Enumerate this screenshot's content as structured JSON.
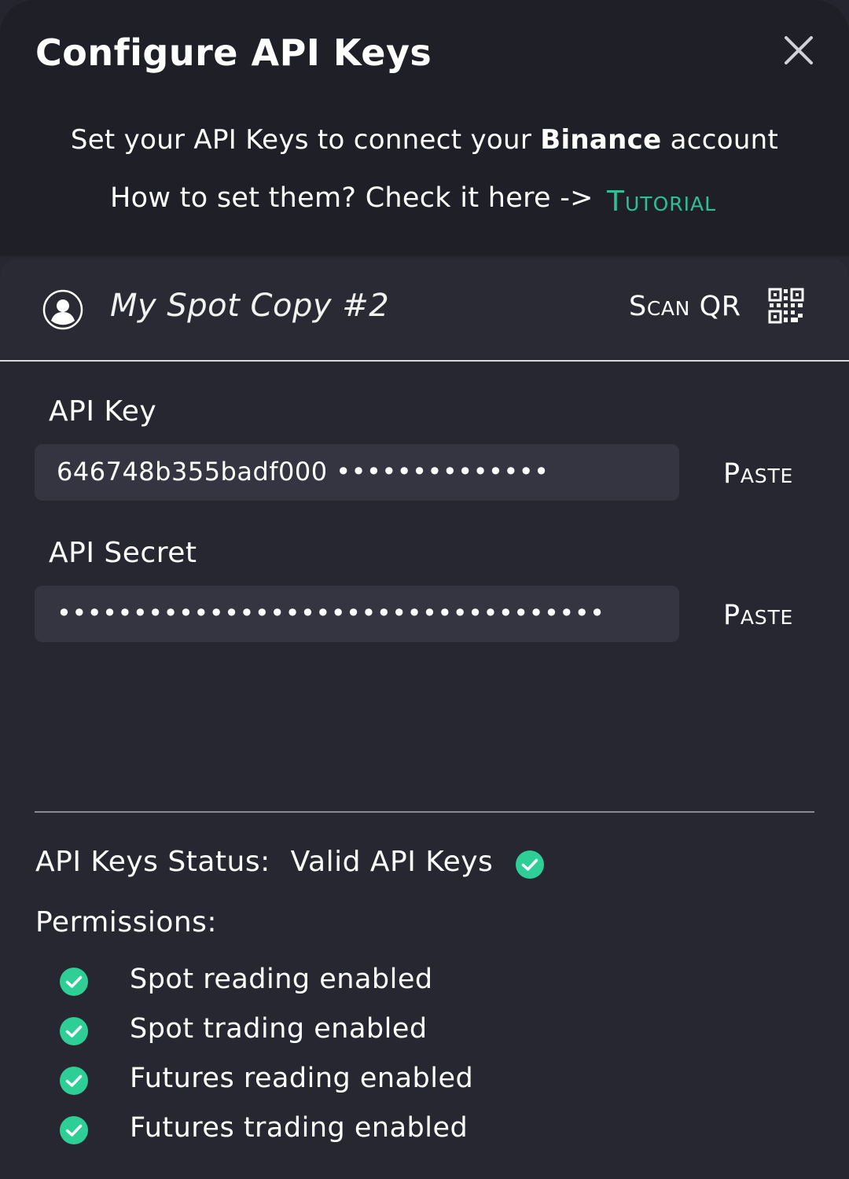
{
  "modal": {
    "title": "Configure API Keys"
  },
  "intro": {
    "line1_prefix": "Set your API Keys to connect your ",
    "exchange": "Binance",
    "line1_suffix": " account",
    "howto_text": "How to set them? Check it here ->",
    "tutorial_label": "Tutorial"
  },
  "account": {
    "name": "My Spot Copy #2",
    "scan_qr_label": "Scan QR"
  },
  "api_key": {
    "label": "API Key",
    "value": "646748b355badf000 ••••••••••••••",
    "paste_label": "Paste"
  },
  "api_secret": {
    "label": "API Secret",
    "value": "••••••••••••••••••••••••••••••••••••",
    "paste_label": "Paste"
  },
  "status": {
    "label": "API Keys Status:",
    "value": "Valid API Keys"
  },
  "permissions": {
    "title": "Permissions:",
    "items": [
      "Spot reading enabled",
      "Spot trading enabled",
      "Futures reading enabled",
      "Futures trading enabled"
    ]
  },
  "colors": {
    "accent": "#2fbf97",
    "check_green": "#2ecf97",
    "background": "#272731",
    "input_bg": "#353542"
  },
  "icons": {
    "close": "close-icon",
    "avatar": "user-avatar-icon",
    "qr": "qr-code-icon",
    "check": "check-circle-icon"
  }
}
